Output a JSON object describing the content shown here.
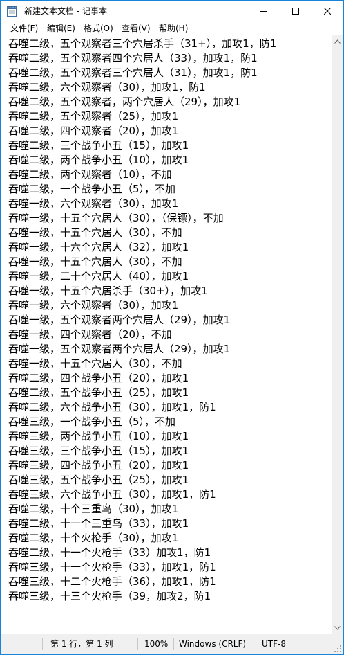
{
  "window": {
    "title": "新建文本文档 - 记事本",
    "accent_color": "#1883d7",
    "icons": [
      "notepad-icon",
      "minimize-icon",
      "maximize-icon",
      "close-icon"
    ]
  },
  "menu": {
    "items": [
      "文件(F)",
      "编辑(E)",
      "格式(O)",
      "查看(V)",
      "帮助(H)"
    ]
  },
  "editor": {
    "lines": [
      "吞噬二级，五个观察者三个穴居杀手（31+），加攻1，防1",
      "吞噬二级，五个观察者四个穴居人（33），加攻1，防1",
      "吞噬二级，五个观察者三个穴居人（31），加攻1，防1",
      "吞噬二级，六个观察者（30），加攻1，防1",
      "吞噬二级，五个观察者，两个穴居人（29），加攻1",
      "吞噬二级，五个观察者（25），加攻1",
      "吞噬二级，四个观察者（20），加攻1",
      "吞噬二级，三个战争小丑（15），加攻1",
      "吞噬二级，两个战争小丑（10），加攻1",
      "吞噬二级，两个观察者（10），不加",
      "吞噬二级，一个战争小丑（5），不加",
      "吞噬一级，六个观察者（30），加攻1",
      "吞噬一级，十五个穴居人（30），（保镖），不加",
      "吞噬一级，十五个穴居人（30），不加",
      "吞噬一级，十六个穴居人（32），加攻1",
      "吞噬一级，十五个穴居人（30），不加",
      "吞噬一级，二十个穴居人（40），加攻1",
      "吞噬一级，十五个穴居杀手（30+），加攻1",
      "吞噬一级，六个观察者（30），加攻1",
      "吞噬一级，五个观察者两个穴居人（29），加攻1",
      "吞噬一级，四个观察者（20），不加",
      "吞噬一级，五个观察者两个穴居人（29），加攻1",
      "吞噬一级，十五个穴居人（30），不加",
      "吞噬二级，四个战争小丑（20），加攻1",
      "吞噬二级，五个战争小丑（25），加攻1",
      "吞噬二级，六个战争小丑（30），加攻1，防1",
      "吞噬三级，一个战争小丑（5），不加",
      "吞噬三级，两个战争小丑（10），加攻1",
      "吞噬三级，三个战争小丑（15），加攻1",
      "吞噬三级，四个战争小丑（20），加攻1",
      "吞噬三级，五个战争小丑（25），加攻1",
      "吞噬三级，六个战争小丑（30），加攻1，防1",
      "吞噬二级，十个三重鸟（30），加攻1",
      "吞噬二级，十一个三重鸟（33），加攻1",
      "吞噬二级，十个火枪手（30），加攻1",
      "吞噬二级，十一个火枪手（33）加攻1，防1",
      "吞噬三级，十一个火枪手（33），加攻1，防1",
      "吞噬三级，十二个火枪手（36），加攻1，防1",
      "吞噬三级，十三个火枪手（39，加攻2，防1"
    ]
  },
  "status": {
    "position": "第 1 行，第 1 列",
    "zoom": "100%",
    "line_ending": "Windows (CRLF)",
    "encoding": "UTF-8"
  }
}
